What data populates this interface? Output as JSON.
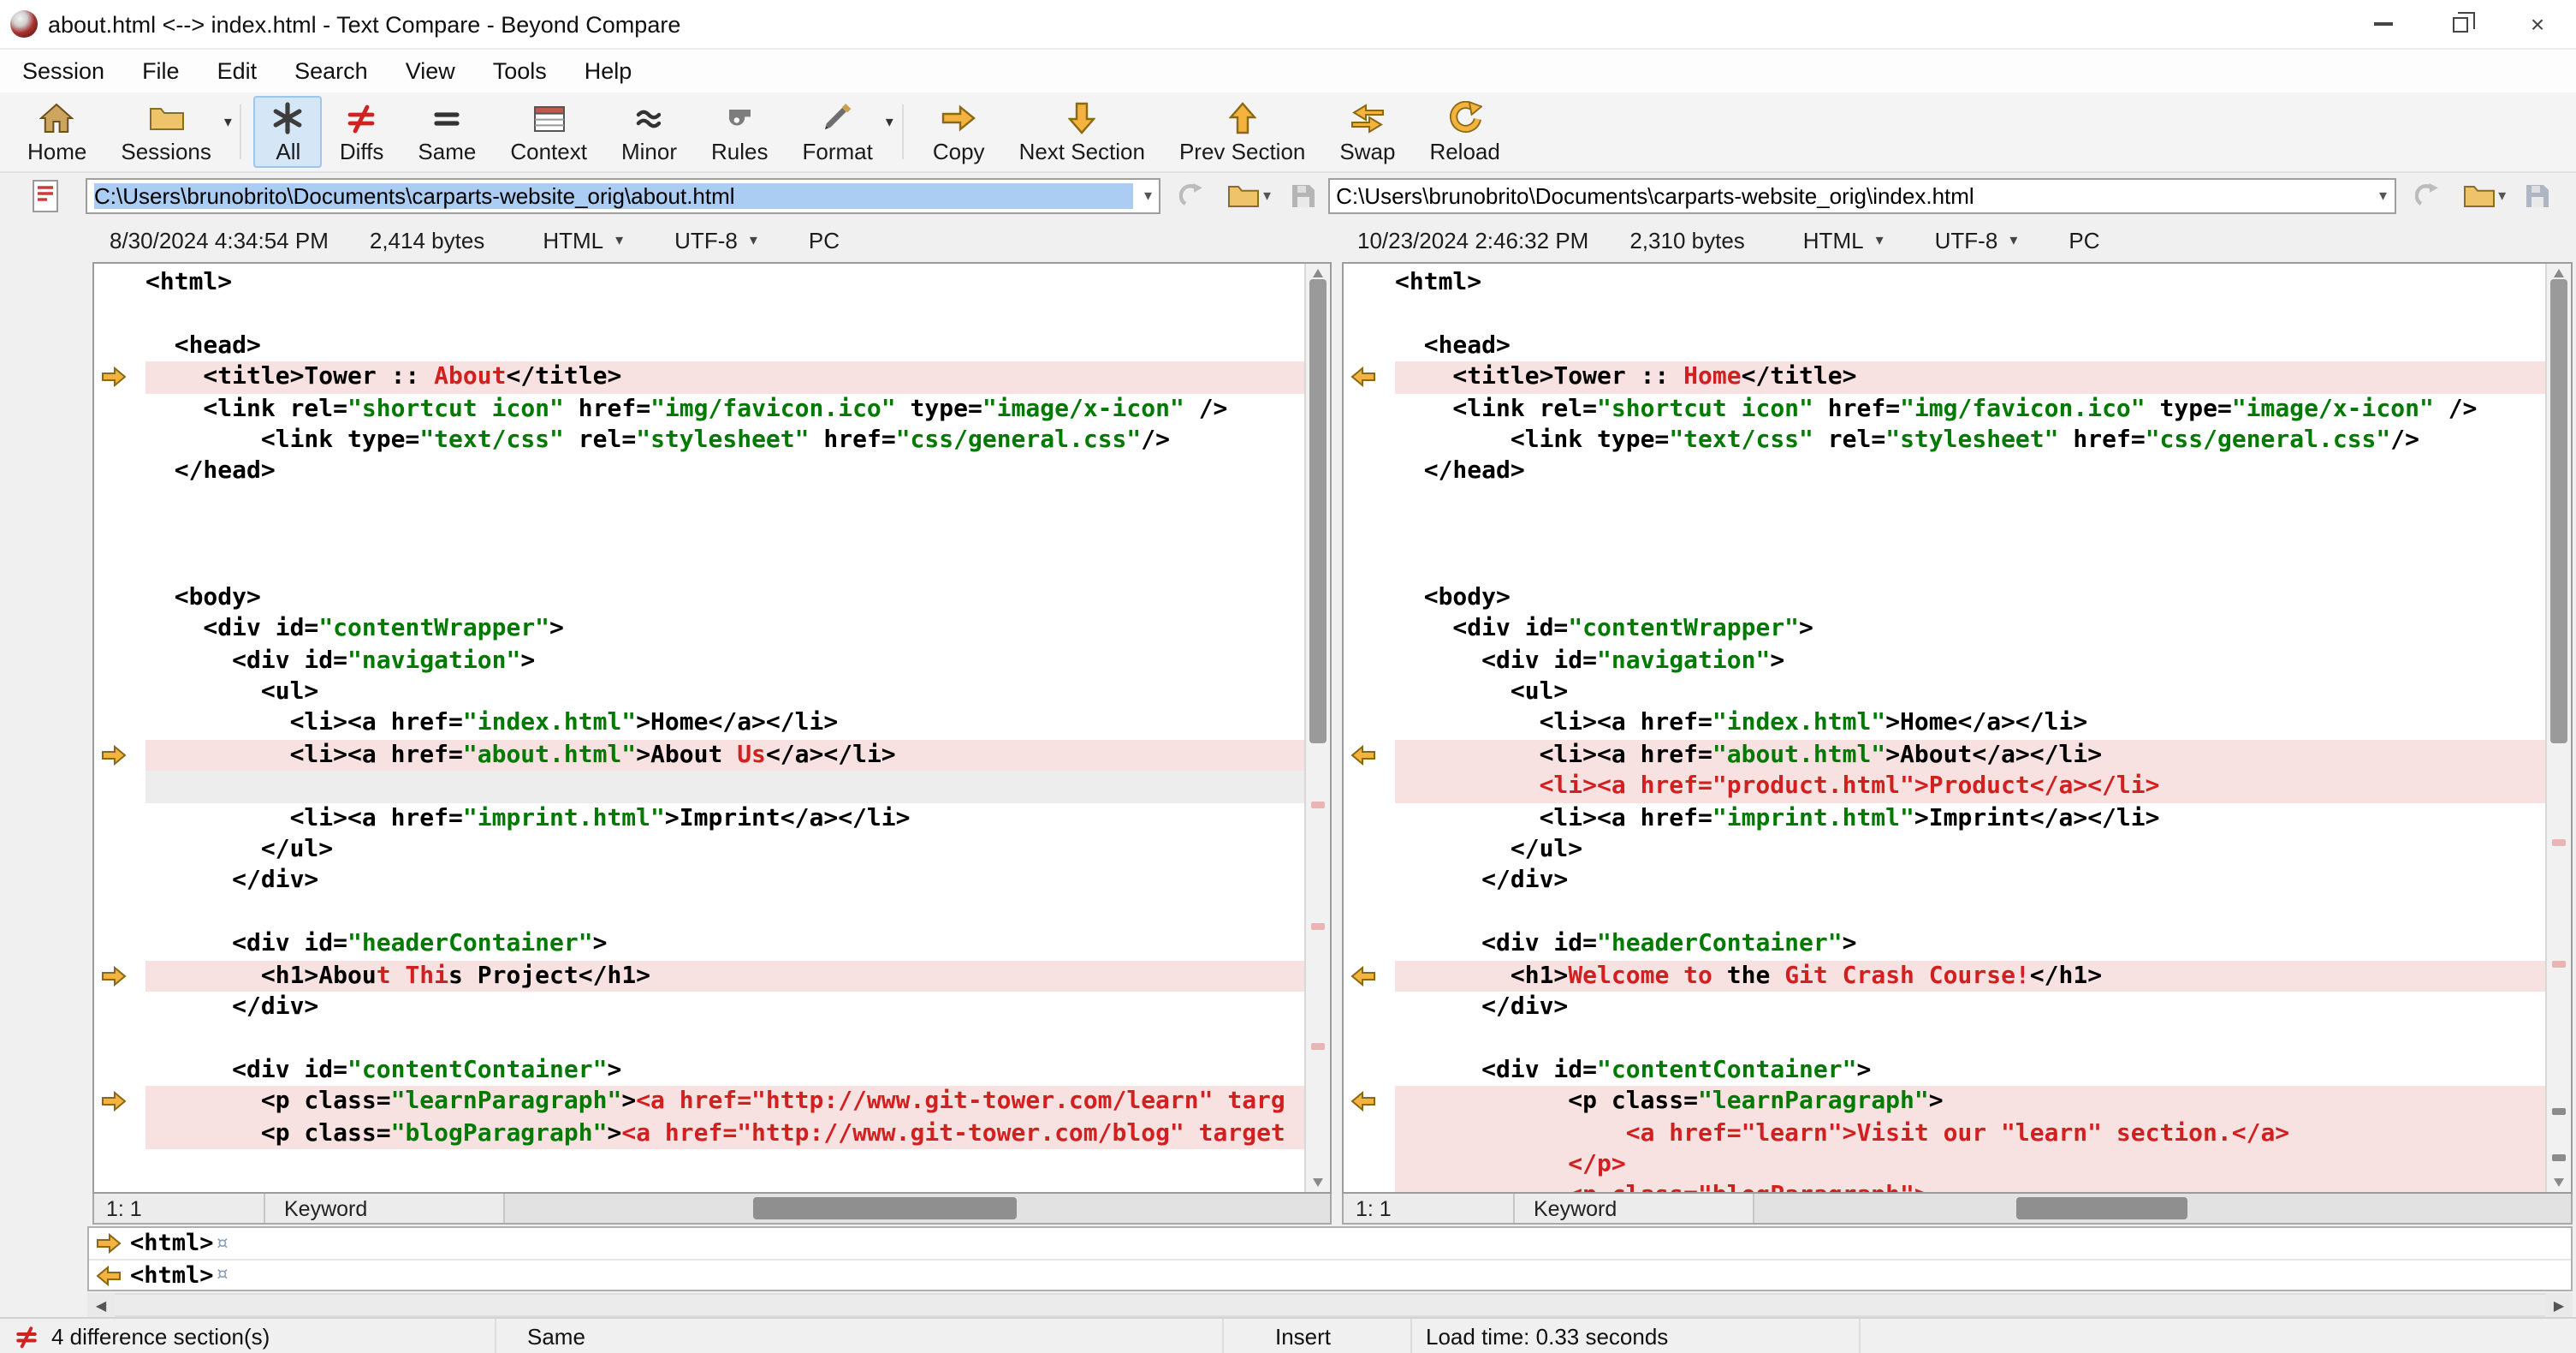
{
  "window": {
    "title": "about.html <--> index.html - Text Compare - Beyond Compare"
  },
  "icons": {
    "caret_down": "▾",
    "close": "×",
    "scroll_left": "◀",
    "scroll_right": "▶"
  },
  "colors": {
    "diff_background": "#f7e1e1",
    "diff_text": "#d21f1f",
    "string_text": "#007a00",
    "section_arrow": "#F4B23E",
    "path_selection": "#abcdf3"
  },
  "menu": [
    "Session",
    "File",
    "Edit",
    "Search",
    "View",
    "Tools",
    "Help"
  ],
  "toolbar": [
    {
      "label": "Home"
    },
    {
      "label": "Sessions"
    },
    {
      "label": "All"
    },
    {
      "label": "Diffs"
    },
    {
      "label": "Same"
    },
    {
      "label": "Context"
    },
    {
      "label": "Minor"
    },
    {
      "label": "Rules"
    },
    {
      "label": "Format"
    },
    {
      "label": "Copy"
    },
    {
      "label": "Next Section"
    },
    {
      "label": "Prev Section"
    },
    {
      "label": "Swap"
    },
    {
      "label": "Reload"
    }
  ],
  "left_pane": {
    "path": "C:\\Users\\brunobrito\\Documents\\carparts-website_orig\\about.html",
    "modified": "8/30/2024 4:34:54 PM",
    "size": "2,414 bytes",
    "format": "HTML",
    "encoding": "UTF-8",
    "line_ending": "PC",
    "cursor_position": "1: 1",
    "syntax_item": "Keyword",
    "lines": [
      {
        "s": [
          [
            "<html>",
            "k"
          ]
        ]
      },
      {
        "s": []
      },
      {
        "s": [
          [
            "  <head>",
            "k"
          ]
        ]
      },
      {
        "b": "d",
        "a": true,
        "s": [
          [
            "    <title>Tower :: ",
            "k"
          ],
          [
            "About",
            "r"
          ],
          [
            "</title>",
            "k"
          ]
        ]
      },
      {
        "s": [
          [
            "    <link rel=",
            "k"
          ],
          [
            "\"shortcut icon\"",
            "g"
          ],
          [
            " href=",
            "k"
          ],
          [
            "\"img/favicon.ico\"",
            "g"
          ],
          [
            " type=",
            "k"
          ],
          [
            "\"image/x-icon\"",
            "g"
          ],
          [
            " />",
            "k"
          ]
        ]
      },
      {
        "s": [
          [
            "        <link type=",
            "k"
          ],
          [
            "\"text/css\"",
            "g"
          ],
          [
            " rel=",
            "k"
          ],
          [
            "\"stylesheet\"",
            "g"
          ],
          [
            " href=",
            "k"
          ],
          [
            "\"css/general.css\"",
            "g"
          ],
          [
            "/>",
            "k"
          ]
        ]
      },
      {
        "s": [
          [
            "  </head>",
            "k"
          ]
        ]
      },
      {
        "s": []
      },
      {
        "s": []
      },
      {
        "s": []
      },
      {
        "s": [
          [
            "  <body>",
            "k"
          ]
        ]
      },
      {
        "s": [
          [
            "    <div id=",
            "k"
          ],
          [
            "\"contentWrapper\"",
            "g"
          ],
          [
            ">",
            "k"
          ]
        ]
      },
      {
        "s": [
          [
            "      <div id=",
            "k"
          ],
          [
            "\"navigation\"",
            "g"
          ],
          [
            ">",
            "k"
          ]
        ]
      },
      {
        "s": [
          [
            "        <ul>",
            "k"
          ]
        ]
      },
      {
        "s": [
          [
            "          <li><a href=",
            "k"
          ],
          [
            "\"index.html\"",
            "g"
          ],
          [
            ">Home</a></li>",
            "k"
          ]
        ]
      },
      {
        "b": "d",
        "a": true,
        "s": [
          [
            "          <li><a href=",
            "k"
          ],
          [
            "\"about.html\"",
            "g"
          ],
          [
            ">About",
            "k"
          ],
          [
            " Us",
            "r"
          ],
          [
            "</a></li>",
            "k"
          ]
        ]
      },
      {
        "b": "g",
        "s": []
      },
      {
        "s": [
          [
            "          <li><a href=",
            "k"
          ],
          [
            "\"imprint.html\"",
            "g"
          ],
          [
            ">Imprint</a></li>",
            "k"
          ]
        ]
      },
      {
        "s": [
          [
            "        </ul>",
            "k"
          ]
        ]
      },
      {
        "s": [
          [
            "      </div>",
            "k"
          ]
        ]
      },
      {
        "s": []
      },
      {
        "s": [
          [
            "      <div id=",
            "k"
          ],
          [
            "\"headerContainer\"",
            "g"
          ],
          [
            ">",
            "k"
          ]
        ]
      },
      {
        "b": "d",
        "a": true,
        "s": [
          [
            "        <h1>Abou",
            "k"
          ],
          [
            "t Thi",
            "r"
          ],
          [
            "s Project</h1>",
            "k"
          ]
        ]
      },
      {
        "s": [
          [
            "      </div>",
            "k"
          ]
        ]
      },
      {
        "s": []
      },
      {
        "s": [
          [
            "      <div id=",
            "k"
          ],
          [
            "\"contentContainer\"",
            "g"
          ],
          [
            ">",
            "k"
          ]
        ]
      },
      {
        "b": "d",
        "a": true,
        "s": [
          [
            "        <p class=",
            "k"
          ],
          [
            "\"learnParagraph\"",
            "g"
          ],
          [
            ">",
            "k"
          ],
          [
            "<a href=\"http://www.git-tower.com/learn\" targ",
            "r"
          ]
        ]
      },
      {
        "b": "d",
        "s": [
          [
            "        <p class=",
            "k"
          ],
          [
            "\"blogParagraph\"",
            "g"
          ],
          [
            ">",
            "k"
          ],
          [
            "<a href=\"http://www.git-tower.com/blog\" target",
            "r"
          ]
        ]
      },
      {
        "s": []
      },
      {
        "s": []
      }
    ]
  },
  "right_pane": {
    "path": "C:\\Users\\brunobrito\\Documents\\carparts-website_orig\\index.html",
    "modified": "10/23/2024 2:46:32 PM",
    "size": "2,310 bytes",
    "format": "HTML",
    "encoding": "UTF-8",
    "line_ending": "PC",
    "cursor_position": "1: 1",
    "syntax_item": "Keyword",
    "lines": [
      {
        "s": [
          [
            "<html>",
            "k"
          ]
        ]
      },
      {
        "s": []
      },
      {
        "s": [
          [
            "  <head>",
            "k"
          ]
        ]
      },
      {
        "b": "d",
        "a": true,
        "s": [
          [
            "    <title>Tower :: ",
            "k"
          ],
          [
            "Home",
            "r"
          ],
          [
            "</title>",
            "k"
          ]
        ]
      },
      {
        "s": [
          [
            "    <link rel=",
            "k"
          ],
          [
            "\"shortcut icon\"",
            "g"
          ],
          [
            " href=",
            "k"
          ],
          [
            "\"img/favicon.ico\"",
            "g"
          ],
          [
            " type=",
            "k"
          ],
          [
            "\"image/x-icon\"",
            "g"
          ],
          [
            " />",
            "k"
          ]
        ]
      },
      {
        "s": [
          [
            "        <link type=",
            "k"
          ],
          [
            "\"text/css\"",
            "g"
          ],
          [
            " rel=",
            "k"
          ],
          [
            "\"stylesheet\"",
            "g"
          ],
          [
            " href=",
            "k"
          ],
          [
            "\"css/general.css\"",
            "g"
          ],
          [
            "/>",
            "k"
          ]
        ]
      },
      {
        "s": [
          [
            "  </head>",
            "k"
          ]
        ]
      },
      {
        "s": []
      },
      {
        "s": []
      },
      {
        "s": []
      },
      {
        "s": [
          [
            "  <body>",
            "k"
          ]
        ]
      },
      {
        "s": [
          [
            "    <div id=",
            "k"
          ],
          [
            "\"contentWrapper\"",
            "g"
          ],
          [
            ">",
            "k"
          ]
        ]
      },
      {
        "s": [
          [
            "      <div id=",
            "k"
          ],
          [
            "\"navigation\"",
            "g"
          ],
          [
            ">",
            "k"
          ]
        ]
      },
      {
        "s": [
          [
            "        <ul>",
            "k"
          ]
        ]
      },
      {
        "s": [
          [
            "          <li><a href=",
            "k"
          ],
          [
            "\"index.html\"",
            "g"
          ],
          [
            ">Home</a></li>",
            "k"
          ]
        ]
      },
      {
        "b": "d",
        "a": true,
        "s": [
          [
            "          <li><a href=",
            "k"
          ],
          [
            "\"about.html\"",
            "g"
          ],
          [
            ">About</a></li>",
            "k"
          ]
        ]
      },
      {
        "b": "d",
        "s": [
          [
            "          <li><a href=\"product.html\">Product</a></li>",
            "r"
          ]
        ]
      },
      {
        "s": [
          [
            "          <li><a href=",
            "k"
          ],
          [
            "\"imprint.html\"",
            "g"
          ],
          [
            ">Imprint</a></li>",
            "k"
          ]
        ]
      },
      {
        "s": [
          [
            "        </ul>",
            "k"
          ]
        ]
      },
      {
        "s": [
          [
            "      </div>",
            "k"
          ]
        ]
      },
      {
        "s": []
      },
      {
        "s": [
          [
            "      <div id=",
            "k"
          ],
          [
            "\"headerContainer\"",
            "g"
          ],
          [
            ">",
            "k"
          ]
        ]
      },
      {
        "b": "d",
        "a": true,
        "s": [
          [
            "        <h1>",
            "k"
          ],
          [
            "Welcome to ",
            "r"
          ],
          [
            "the",
            "k"
          ],
          [
            " Git Crash Course!",
            "r"
          ],
          [
            "</h1>",
            "k"
          ]
        ]
      },
      {
        "s": [
          [
            "      </div>",
            "k"
          ]
        ]
      },
      {
        "s": []
      },
      {
        "s": [
          [
            "      <div id=",
            "k"
          ],
          [
            "\"contentContainer\"",
            "g"
          ],
          [
            ">",
            "k"
          ]
        ]
      },
      {
        "b": "d",
        "a": true,
        "s": [
          [
            "            <p class=",
            "k"
          ],
          [
            "\"learnParagraph\"",
            "g"
          ],
          [
            ">",
            "k"
          ]
        ]
      },
      {
        "b": "d",
        "s": [
          [
            "                <a href=\"learn\">Visit our \"learn\" section.</a>",
            "r"
          ]
        ]
      },
      {
        "b": "d",
        "s": [
          [
            "            </p>",
            "r"
          ]
        ]
      },
      {
        "b": "d",
        "s": [
          [
            "            <p class=\"blogParagraph\">",
            "r"
          ]
        ]
      }
    ]
  },
  "detail_rows": [
    {
      "direction": "right",
      "text": "<html>",
      "eol": "¤"
    },
    {
      "direction": "left",
      "text": "<html>",
      "eol": "¤"
    }
  ],
  "status_bar": {
    "differences": "4 difference section(s)",
    "comparison": "Same",
    "mode": "Insert",
    "load_time": "Load time: 0.33 seconds"
  }
}
